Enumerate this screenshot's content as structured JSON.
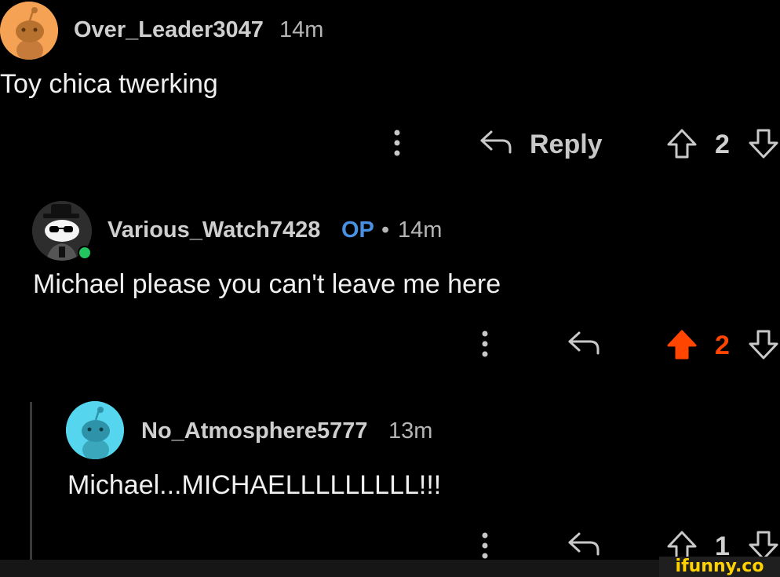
{
  "colors": {
    "background": "#000000",
    "op_badge": "#4a90e2",
    "upvoted": "#ff4500",
    "online": "#22c55e",
    "watermark": "#ffd200"
  },
  "comments": [
    {
      "username": "Over_Leader3047",
      "time": "14m",
      "body": "Toy chica twerking",
      "avatar_icon": "snoo-orange-avatar-icon",
      "actions": {
        "more_icon": "more-vertical-icon",
        "reply_icon": "reply-arrow-icon",
        "reply_label": "Reply",
        "upvote_icon": "upvote-outline-icon",
        "score": "2",
        "downvote_icon": "downvote-outline-icon"
      }
    },
    {
      "username": "Various_Watch7428",
      "op_label": "OP",
      "separator": "•",
      "time": "14m",
      "body": "Michael please you can't leave me here",
      "avatar_icon": "snoo-sunglasses-hat-avatar-icon",
      "online": true,
      "actions": {
        "more_icon": "more-vertical-icon",
        "reply_icon": "reply-arrow-icon",
        "upvote_icon": "upvote-filled-icon",
        "upvoted": true,
        "score": "2",
        "downvote_icon": "downvote-outline-icon"
      }
    },
    {
      "username": "No_Atmosphere5777",
      "time": "13m",
      "body": "Michael...MICHAELLLLLLLLL!!!",
      "avatar_icon": "snoo-teal-avatar-icon",
      "actions": {
        "more_icon": "more-vertical-icon",
        "reply_icon": "reply-arrow-icon",
        "upvote_icon": "upvote-outline-icon",
        "score": "1",
        "downvote_icon": "downvote-outline-icon"
      }
    }
  ],
  "watermark": {
    "text": "ifunny.co"
  }
}
